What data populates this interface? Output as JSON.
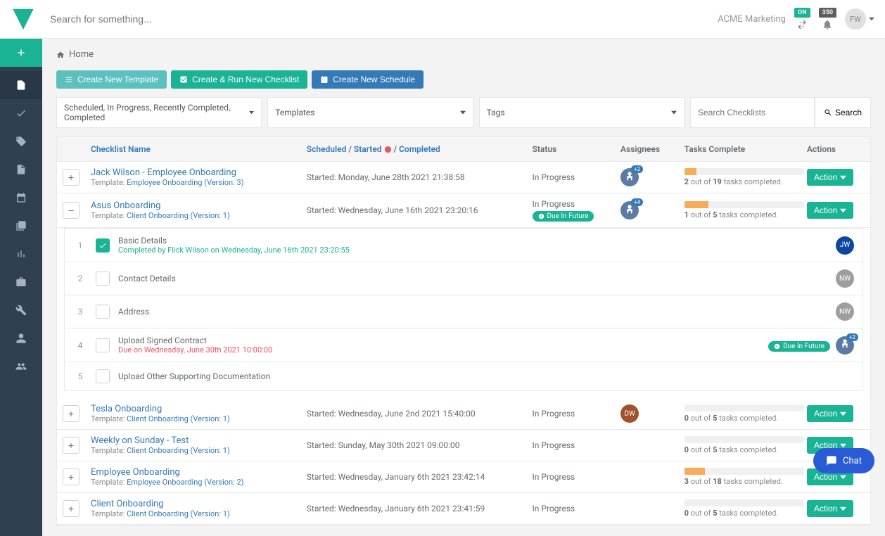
{
  "topbar": {
    "search_placeholder": "Search for something...",
    "org_name": "ACME Marketing",
    "badge_on": "ON",
    "badge_count": "350",
    "avatar_initials": "FW"
  },
  "breadcrumb": {
    "home": "Home"
  },
  "buttons": {
    "create_template": "Create New Template",
    "create_run": "Create & Run New Checklist",
    "create_schedule": "Create New Schedule"
  },
  "filters": {
    "status": "Scheduled, In Progress, Recently Completed, Completed",
    "templates": "Templates",
    "tags": "Tags",
    "search_placeholder": "Search Checklists",
    "search_btn": "Search"
  },
  "headers": {
    "name": "Checklist Name",
    "scheduled": "Scheduled",
    "started": "Started",
    "completed": "Completed",
    "status": "Status",
    "assignees": "Assignees",
    "tasks": "Tasks Complete",
    "actions": "Actions"
  },
  "rows": [
    {
      "name": "Jack Wilson - Employee Onboarding",
      "template_prefix": "Template: ",
      "template": "Employee Onboarding (Version: 3)",
      "started": "Started: Monday, June 28th 2021 21:38:58",
      "status": "In Progress",
      "assignee_extra": "+2",
      "progress_pct": 10,
      "tasks_done": "2",
      "tasks_total": "19",
      "tasks_text_mid": " out of ",
      "tasks_text_end": " tasks completed.",
      "action": "Action"
    },
    {
      "name": "Asus Onboarding",
      "template_prefix": "Template: ",
      "template": "Client Onboarding (Version: 1)",
      "started": "Started: Wednesday, June 16th 2021 23:20:16",
      "status": "In Progress",
      "due_badge": "Due In Future",
      "assignee_extra": "+4",
      "progress_pct": 20,
      "tasks_done": "1",
      "tasks_total": "5",
      "tasks_text_mid": " out of ",
      "tasks_text_end": " tasks completed.",
      "action": "Action"
    },
    {
      "name": "Tesla Onboarding",
      "template_prefix": "Template: ",
      "template": "Client Onboarding (Version: 1)",
      "started": "Started: Wednesday, June 2nd 2021 15:40:00",
      "status": "In Progress",
      "assignee_initials": "DW",
      "progress_pct": 0,
      "tasks_done": "0",
      "tasks_total": "5",
      "tasks_text_mid": " out of ",
      "tasks_text_end": " tasks completed.",
      "action": "Action"
    },
    {
      "name": "Weekly on Sunday - Test",
      "template_prefix": "Template: ",
      "template": "Client Onboarding (Version: 1)",
      "started": "Started: Sunday, May 30th 2021 09:00:00",
      "status": "In Progress",
      "progress_pct": 0,
      "tasks_done": "0",
      "tasks_total": "5",
      "tasks_text_mid": " out of ",
      "tasks_text_end": " tasks completed.",
      "action": "Action"
    },
    {
      "name": "Employee Onboarding",
      "template_prefix": "Template: ",
      "template": "Employee Onboarding (Version: 2)",
      "started": "Started: Wednesday, January 6th 2021 23:42:14",
      "status": "In Progress",
      "progress_pct": 17,
      "tasks_done": "3",
      "tasks_total": "18",
      "tasks_text_mid": " out of ",
      "tasks_text_end": " tasks completed.",
      "action": "Action"
    },
    {
      "name": "Client Onboarding",
      "template_prefix": "Template: ",
      "template": "Client Onboarding (Version: 1)",
      "started": "Started: Wednesday, January 6th 2021 23:41:59",
      "status": "In Progress",
      "progress_pct": 0,
      "tasks_done": "0",
      "tasks_total": "5",
      "tasks_text_mid": " out of ",
      "tasks_text_end": " tasks completed.",
      "action": "Action"
    }
  ],
  "subtasks": [
    {
      "num": "1",
      "done": true,
      "title": "Basic Details",
      "meta": "Completed by Flick Wilson on Wednesday, June 16th 2021 23:20:55",
      "avatar": "JW",
      "avatar_class": "blue"
    },
    {
      "num": "2",
      "done": false,
      "title": "Contact Details",
      "avatar": "NW",
      "avatar_class": "gray"
    },
    {
      "num": "3",
      "done": false,
      "title": "Address",
      "avatar": "NW",
      "avatar_class": "gray"
    },
    {
      "num": "4",
      "done": false,
      "title": "Upload Signed Contract",
      "meta": "Due on Wednesday, June 30th 2021 10:00:00",
      "meta_due": true,
      "due_badge": "Due In Future",
      "avatar_extra": "+2"
    },
    {
      "num": "5",
      "done": false,
      "title": "Upload Other Supporting Documentation"
    }
  ],
  "chat": {
    "label": "Chat"
  }
}
